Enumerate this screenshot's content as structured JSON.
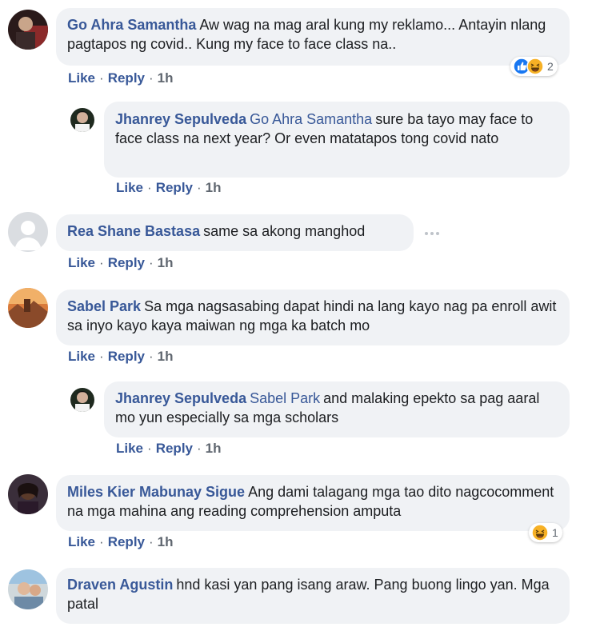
{
  "comments": [
    {
      "author": "Go Ahra Samantha",
      "text": "Aw wag na mag aral kung my reklamo... Antayin nlang pagtapos ng covid.. Kung my face to face class na..",
      "like": "Like",
      "reply": "Reply",
      "time": "1h",
      "reaction_count": "2"
    },
    {
      "author": "Jhanrey Sepulveda",
      "mention": "Go Ahra Samantha",
      "text": "sure ba tayo may face to face class na next year? Or even matatapos tong covid nato",
      "like": "Like",
      "reply": "Reply",
      "time": "1h"
    },
    {
      "author": "Rea Shane Bastasa",
      "text": "same sa akong manghod",
      "like": "Like",
      "reply": "Reply",
      "time": "1h"
    },
    {
      "author": "Sabel Park",
      "text": "Sa mga nagsasabing dapat hindi na lang kayo nag pa enroll awit sa inyo kayo kaya maiwan ng mga ka batch mo",
      "like": "Like",
      "reply": "Reply",
      "time": "1h"
    },
    {
      "author": "Jhanrey Sepulveda",
      "mention": "Sabel Park",
      "text": "and malaking epekto sa pag aaral mo yun especially sa mga scholars",
      "like": "Like",
      "reply": "Reply",
      "time": "1h"
    },
    {
      "author": "Miles Kier Mabunay Sigue",
      "text": "Ang dami talagang mga tao dito nagcocomment na mga mahina ang reading comprehension amputa",
      "like": "Like",
      "reply": "Reply",
      "time": "1h",
      "reaction_count": "1"
    },
    {
      "author": "Draven Agustin",
      "text": "hnd kasi yan pang isang araw. Pang buong lingo yan. Mga patal"
    }
  ],
  "colors": {
    "link": "#385898",
    "bubble": "#f0f2f5",
    "meta": "#606770",
    "like_blue": "#1877f2",
    "haha_yellow": "#f7b125"
  },
  "icons": [
    "like-reaction-icon",
    "haha-reaction-icon",
    "more-options-icon"
  ]
}
